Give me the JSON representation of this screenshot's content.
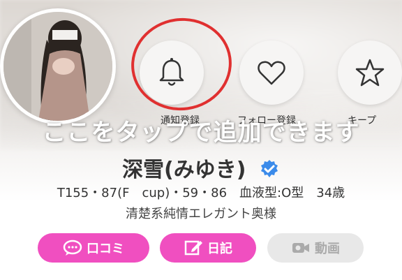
{
  "profile": {
    "name": "深雪(みゆき)",
    "stats": "T155・87(F　cup)・59・86　血液型:O型　34歳",
    "catchphrase": "清楚系純情エレガント奥様"
  },
  "action_buttons": [
    {
      "icon": "bell-icon",
      "label": "通知登録"
    },
    {
      "icon": "heart-icon",
      "label": "フォロー登録"
    },
    {
      "icon": "star-icon",
      "label": "キープ"
    }
  ],
  "overlay": {
    "text": "ここをタップで追加できます"
  },
  "bottom_buttons": [
    {
      "icon": "chat-bubble-icon",
      "label": "口コミ",
      "state": "active"
    },
    {
      "icon": "edit-note-icon",
      "label": "日記",
      "state": "active"
    },
    {
      "icon": "video-camera-icon",
      "label": "動画",
      "state": "disabled"
    }
  ],
  "colors": {
    "accent_pink": "#f04fc0",
    "highlight_red": "#e03030",
    "verified_blue": "#3b8bea",
    "disabled_gray": "#e8e8e8"
  }
}
